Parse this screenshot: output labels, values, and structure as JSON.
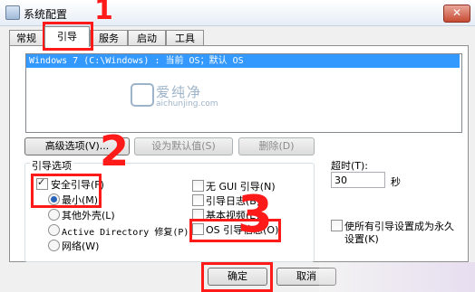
{
  "window": {
    "title": "系统配置",
    "close_glyph": "✕"
  },
  "tabs": [
    {
      "label": "常规"
    },
    {
      "label": "引导"
    },
    {
      "label": "服务"
    },
    {
      "label": "启动"
    },
    {
      "label": "工具"
    }
  ],
  "os_list": {
    "entry": "Windows 7 (C:\\Windows) : 当前 OS；默认 OS"
  },
  "watermark": {
    "title": "爱纯净",
    "subtitle": "aichunjing.com"
  },
  "buttons": {
    "advanced": "高级选项(V)...",
    "set_default": "设为默认值(S)",
    "delete": "删除(D)",
    "ok": "确定",
    "cancel": "取消"
  },
  "boot_options": {
    "group_label": "引导选项",
    "safe_boot": "安全引导(F)",
    "minimal": "最小(M)",
    "alternate_shell": "其他外壳(L)",
    "ad_repair": "Active Directory 修复(P)",
    "network": "网络(W)",
    "no_gui": "无 GUI 引导(N)",
    "boot_log": "引导日志(B)",
    "base_video": "基本视频(E)",
    "os_boot_info": "OS 引导信息(O)"
  },
  "timeout": {
    "label": "超时(T):",
    "value": "30",
    "unit": "秒"
  },
  "make_permanent": {
    "line1": "使所有引导设置成为永久",
    "line2": "设置(K)"
  },
  "annotations": {
    "one": "1",
    "two": "2",
    "three": "3"
  },
  "colors": {
    "highlight": "#3399ff",
    "annotation": "#ff1a1a",
    "watermark": "#9db3c9"
  }
}
